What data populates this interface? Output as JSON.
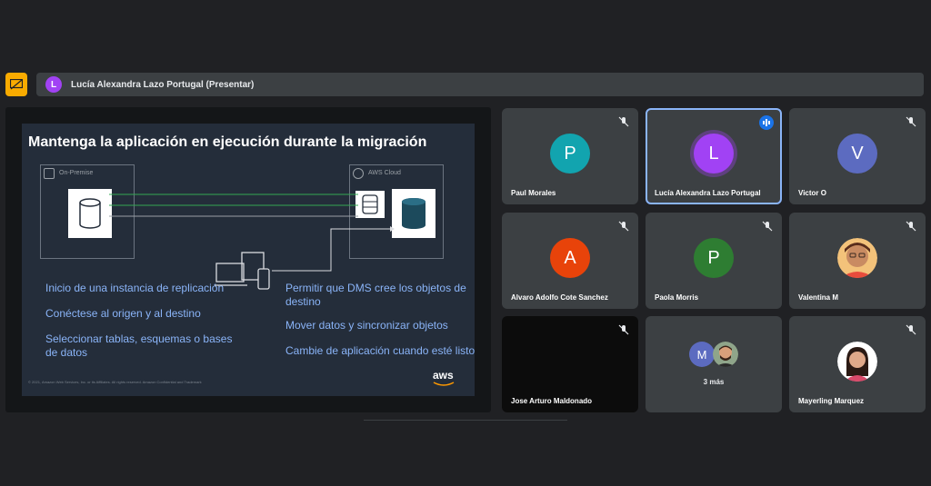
{
  "presenter": {
    "initial": "L",
    "label": "Lucía Alexandra Lazo Portugal (Presentar)",
    "avatar_color": "#a142f4",
    "icon": "present-screen-icon"
  },
  "slide": {
    "title": "Mantenga la aplicación en ejecución durante la migración",
    "on_premise_label": "On-Premise",
    "aws_cloud_label": "AWS Cloud",
    "bullets_left": [
      "Inicio de una instancia de replicación",
      "Conéctese al origen y al destino",
      "Seleccionar tablas, esquemas o bases de datos"
    ],
    "bullets_right": [
      "Permitir que DMS cree los objetos de destino",
      "Mover datos y sincronizar objetos",
      "Cambie de aplicación cuando esté listo"
    ],
    "footnote": "© 2021, Amazon Web Services, Inc. or its Affiliates. All rights reserved. Amazon Confidential and Trademark",
    "logo": "aws",
    "bullet_color": "#8ab4f8",
    "link_color": "#34a853"
  },
  "participants": [
    {
      "name": "Paul Morales",
      "initial": "P",
      "color": "#12a4af",
      "muted": true
    },
    {
      "name": "Lucía Alexandra Lazo Portugal",
      "initial": "L",
      "color": "#a142f4",
      "speaking": true
    },
    {
      "name": "Victor O",
      "initial": "V",
      "color": "#5c6bc0",
      "muted": true
    },
    {
      "name": "Alvaro Adolfo Cote Sanchez",
      "initial": "A",
      "color": "#e8430a",
      "muted": true
    },
    {
      "name": "Paola Morris",
      "initial": "P",
      "color": "#2e7d32",
      "muted": true
    },
    {
      "name": "Valentina M",
      "photo": true,
      "muted": true
    },
    {
      "name": "Jose Arturo Maldonado",
      "video_off": true,
      "muted": true
    },
    {
      "name": "3 más",
      "initial": "M",
      "color": "#5c6bc0"
    },
    {
      "name": "Mayerling Marquez",
      "photo": true,
      "muted": true
    }
  ]
}
